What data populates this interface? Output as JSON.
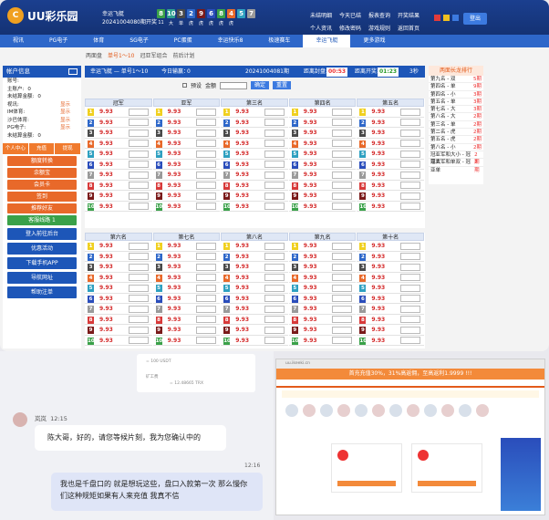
{
  "app": {
    "logo_text": "UU彩乐园",
    "logo_mark": "C"
  },
  "draw": {
    "game": "幸运飞艇",
    "issue_text": "20241004080期开奖",
    "numbers": [
      {
        "n": "8",
        "color": "#3aa149"
      },
      {
        "n": "10",
        "color": "#2ea08f"
      },
      {
        "n": "3",
        "color": "#4a4a4a"
      },
      {
        "n": "2",
        "color": "#2e67c9"
      },
      {
        "n": "9",
        "color": "#7a1a1a"
      },
      {
        "n": "6",
        "color": "#2a4dbb"
      },
      {
        "n": "8",
        "color": "#3aa149"
      },
      {
        "n": "4",
        "color": "#e8692a"
      },
      {
        "n": "5",
        "color": "#2ea0c0"
      },
      {
        "n": "7",
        "color": "#9a9a9a"
      }
    ],
    "labels": [
      "11",
      "大",
      "单",
      "虎",
      "虎",
      "虎",
      "虎",
      "虎",
      "",
      ""
    ]
  },
  "top_links": [
    "未结明细",
    "今天已结",
    "报表查询",
    "开奖结果",
    "个人资讯",
    "修改密码",
    "游戏规则",
    "返回首页"
  ],
  "color_dots": [
    "#e23b3b",
    "#f0c020",
    "#3c7ae0"
  ],
  "logout_label": "登出",
  "nav": [
    {
      "label": "视讯",
      "active": false
    },
    {
      "label": "PG电子",
      "active": false
    },
    {
      "label": "体育",
      "active": false
    },
    {
      "label": "SG电子",
      "active": false
    },
    {
      "label": "PC蛋蛋",
      "active": false
    },
    {
      "label": "幸运快乐8",
      "active": false
    },
    {
      "label": "极速赛车",
      "active": false
    },
    {
      "label": "幸运飞艇",
      "active": true
    },
    {
      "label": "更多游戏",
      "active": false
    }
  ],
  "subnav": [
    {
      "label": "两面盘",
      "on": false
    },
    {
      "label": "单号1～10",
      "on": true
    },
    {
      "label": "冠亚军组合",
      "on": false
    },
    {
      "label": "前后计划",
      "on": false
    }
  ],
  "sidebar": {
    "title": "帐户信息",
    "rows": [
      {
        "label": "账号:",
        "value": "",
        "show": ""
      },
      {
        "label": "主账户:",
        "value": "0",
        "show": ""
      },
      {
        "label": "未结算金额:",
        "value": "0",
        "show": ""
      },
      {
        "label": "视讯:",
        "value": "",
        "show": "显示"
      },
      {
        "label": "IM体育:",
        "value": "",
        "show": "显示"
      },
      {
        "label": "沙巴体育:",
        "value": "",
        "show": "显示"
      },
      {
        "label": "PG电子:",
        "value": "",
        "show": "显示"
      },
      {
        "label": "未结算金额:",
        "value": "0",
        "show": ""
      }
    ],
    "tabs": [
      "个人中心",
      "充值",
      "提现"
    ],
    "buttons": [
      "额度转换",
      "余额宝",
      "会员卡",
      "签到",
      "推荐好友"
    ],
    "support": "客服线路 1",
    "blue_buttons": [
      "登入前往后台",
      "优惠活动",
      "下载手机APP",
      "导航网址",
      "帮助注单"
    ]
  },
  "main_head": {
    "title": "幸运飞艇 — 单号1～10",
    "today_label": "今日输赢：",
    "today_value": "0",
    "issue": "20241004081期",
    "close_label": "距离封盘:",
    "close_time": "00:53",
    "open_label": "距离开奖:",
    "open_time": "01:23",
    "seconds": "3秒"
  },
  "filters": {
    "preset": "预设",
    "amount_label": "金额",
    "confirm": "确定",
    "reset": "重置"
  },
  "odds": "9.93",
  "grid1_cols": [
    "冠军",
    "亚军",
    "第三名",
    "第四名",
    "第五名"
  ],
  "grid2_cols": [
    "第六名",
    "第七名",
    "第八名",
    "第九名",
    "第十名"
  ],
  "num_colors": [
    "#f0d020",
    "#2e67c9",
    "#4a4a4a",
    "#e8692a",
    "#2ea0c0",
    "#2a4dbb",
    "#9a9a9a",
    "#d83a3a",
    "#7a1a1a",
    "#3aa149"
  ],
  "ranking": {
    "title": "两面长龙排行",
    "rows": [
      {
        "k": "第九名 - 双",
        "v": "5期"
      },
      {
        "k": "第四名 - 单",
        "v": "9期"
      },
      {
        "k": "第四名 - 小",
        "v": "3期"
      },
      {
        "k": "第五名 - 单",
        "v": "3期"
      },
      {
        "k": "第七名 - 大",
        "v": "3期"
      },
      {
        "k": "第八名 - 大",
        "v": "2期"
      },
      {
        "k": "第三名 - 单",
        "v": "2期"
      },
      {
        "k": "第二名 - 虎",
        "v": "2期"
      },
      {
        "k": "第五名 - 虎",
        "v": "2期"
      },
      {
        "k": "第八名 - 小",
        "v": "2期"
      },
      {
        "k": "冠亚军和大小 - 冠亚大",
        "v": "2期"
      },
      {
        "k": "冠亚军和单双 - 冠亚单",
        "v": "2期"
      }
    ]
  },
  "old_card": {
    "line1": "= 100 USDT",
    "line2": "矿工费",
    "line3": "= 12.48665 TRX"
  },
  "chat": {
    "name": "岚岚",
    "time": "12:15",
    "msg1": "陈大哥，好的，请您等候片刻，我为您确认中的",
    "time2": "12:16",
    "msg2_line1": "我也是千盘口的 就是想玩这些，盘口入款第一次 那么慢你",
    "msg2_line2": "们这种规矩如果有人来充值 我真不信"
  },
  "shot2": {
    "banner": "首充充值30%，31%高返佣，至高返利1.9999 !!!",
    "url": "uu.ikeeki.cn"
  }
}
